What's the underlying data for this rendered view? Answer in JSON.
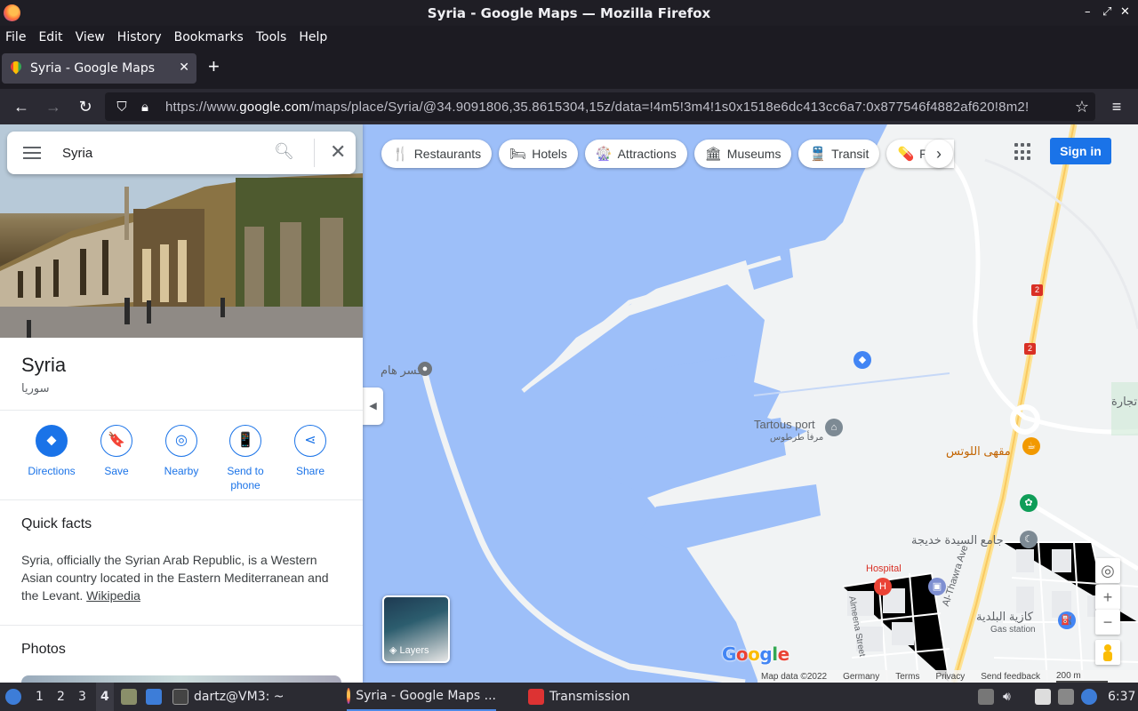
{
  "window": {
    "title": "Syria - Google Maps — Mozilla Firefox",
    "min": "–",
    "max": "⤢",
    "close": "✕"
  },
  "menu": [
    "File",
    "Edit",
    "View",
    "History",
    "Bookmarks",
    "Tools",
    "Help"
  ],
  "tab": {
    "title": "Syria - Google Maps",
    "close": "✕",
    "new": "+"
  },
  "nav": {
    "url_prefix": "https://www.",
    "url_domain": "google.com",
    "url_rest": "/maps/place/Syria/@34.9091806,35.8615304,15z/data=!4m5!3m4!1s0x1518e6dc413cc6a7:0x877546f4882af620!8m2!"
  },
  "maps": {
    "search_value": "Syria",
    "chips": [
      {
        "icon": "🍴",
        "label": "Restaurants"
      },
      {
        "icon": "🛏",
        "label": "Hotels"
      },
      {
        "icon": "🎡",
        "label": "Attractions"
      },
      {
        "icon": "🏛",
        "label": "Museums"
      },
      {
        "icon": "🚆",
        "label": "Transit"
      },
      {
        "icon": "💊",
        "label": "Pha"
      }
    ],
    "signin": "Sign in",
    "labels": {
      "port": "Tartous port",
      "port_ar": "مرفأ طرطوس",
      "makser": "مكسر هام",
      "lotus": "مقهى اللوتس",
      "mosque": "جامع السيدة خديجة",
      "hospital": "Hospital",
      "gas_ar": "كازية البلدية",
      "gas": "Gas station",
      "tijara": "تجارة",
      "thawra": "Al-Thawra Ave",
      "almeena": "Almeena Street",
      "road2a": "2",
      "road2b": "2"
    },
    "layers": "Layers",
    "google": "Google",
    "footer": [
      "Map data ©2022",
      "Germany",
      "Terms",
      "Privacy",
      "Send feedback",
      "200 m"
    ]
  },
  "place": {
    "name": "Syria",
    "name_ar": "سوريا",
    "actions": [
      {
        "label": "Directions",
        "icon": "⬥"
      },
      {
        "label": "Save",
        "icon": "🔖"
      },
      {
        "label": "Nearby",
        "icon": "◎"
      },
      {
        "label": "Send to phone",
        "icon": "📱"
      },
      {
        "label": "Share",
        "icon": "⋖"
      }
    ],
    "quick_facts_title": "Quick facts",
    "description": "Syria, officially the Syrian Arab Republic, is a Western Asian country located in the Eastern Mediterranean and the Levant.",
    "wiki": "Wikipedia",
    "photos_title": "Photos"
  },
  "taskbar": {
    "workspaces": [
      "1",
      "2",
      "3",
      "4"
    ],
    "terminal": "dartz@VM3: ~",
    "firefox": "Syria - Google Maps ...",
    "transmission": "Transmission",
    "clock": "6:37"
  },
  "colors": {
    "accent": "#1a73e8",
    "water": "#9dbff9",
    "land": "#f1f3f4"
  }
}
